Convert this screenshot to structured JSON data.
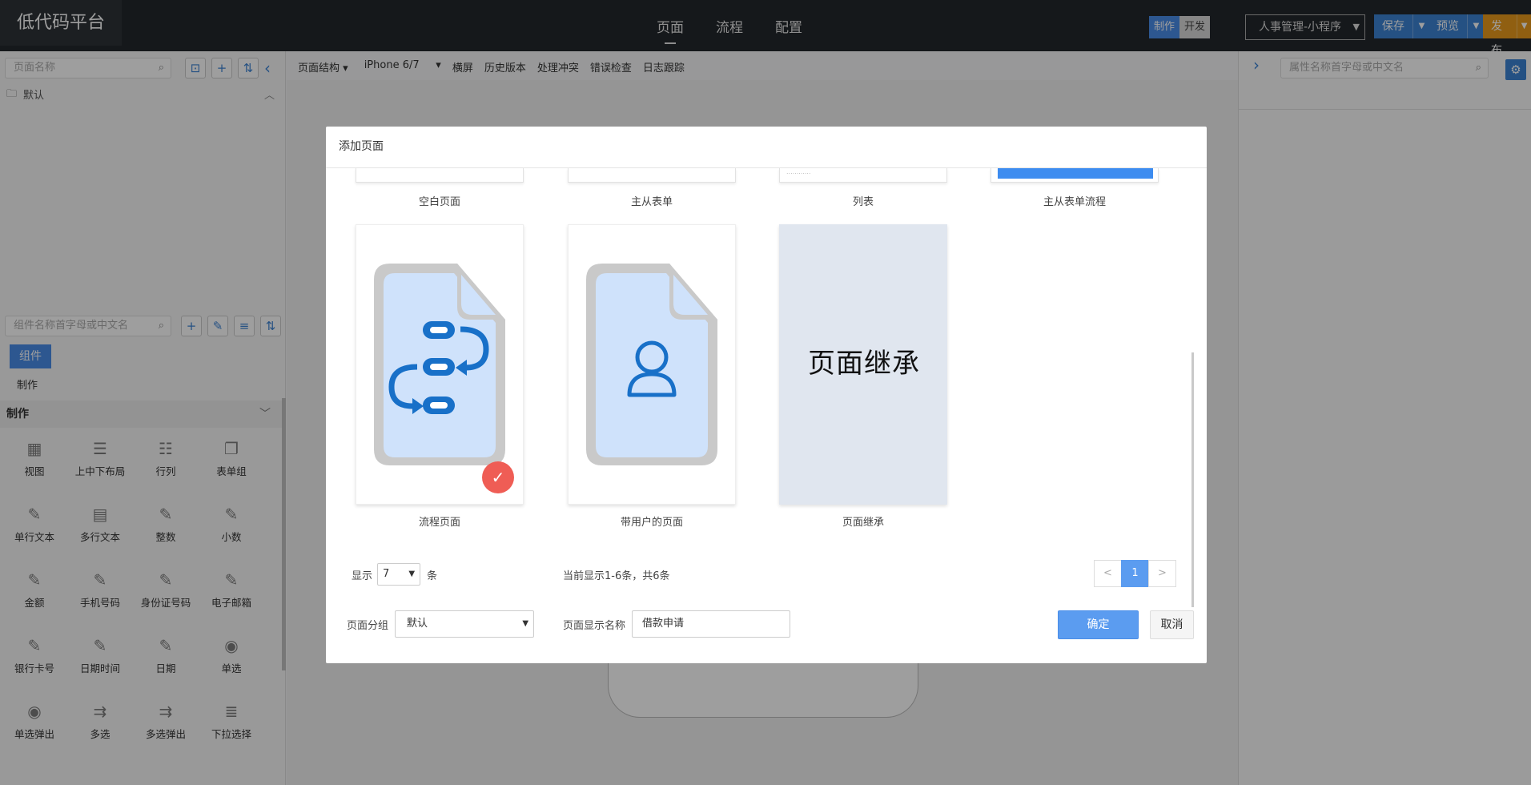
{
  "app": {
    "logo": "低代码平台"
  },
  "topnav": {
    "items": [
      "页面",
      "流程",
      "配置"
    ],
    "active": "页面"
  },
  "mode": {
    "on": "制作",
    "off": "开发"
  },
  "project_select": "人事管理-小程序",
  "toolbar_buttons": {
    "save": "保存",
    "preview": "预览",
    "publish": "发布"
  },
  "left": {
    "page_search_placeholder": "页面名称",
    "folder": "默认",
    "comp_search_placeholder": "组件名称首字母或中文名",
    "tab": "组件",
    "plain_label": "制作",
    "section": "制作",
    "components": [
      {
        "name": "视图",
        "icon": "view-icon"
      },
      {
        "name": "上中下布局",
        "icon": "layout-icon"
      },
      {
        "name": "行列",
        "icon": "rows-icon"
      },
      {
        "name": "表单组",
        "icon": "form-group-icon"
      },
      {
        "name": "单行文本",
        "icon": "edit-icon"
      },
      {
        "name": "多行文本",
        "icon": "textarea-icon"
      },
      {
        "name": "整数",
        "icon": "edit-icon"
      },
      {
        "name": "小数",
        "icon": "edit-icon"
      },
      {
        "name": "金额",
        "icon": "edit-icon"
      },
      {
        "name": "手机号码",
        "icon": "edit-icon"
      },
      {
        "name": "身份证号码",
        "icon": "edit-icon"
      },
      {
        "name": "电子邮箱",
        "icon": "edit-icon"
      },
      {
        "name": "银行卡号",
        "icon": "edit-icon"
      },
      {
        "name": "日期时间",
        "icon": "edit-icon"
      },
      {
        "name": "日期",
        "icon": "edit-icon"
      },
      {
        "name": "单选",
        "icon": "radio-icon"
      },
      {
        "name": "单选弹出",
        "icon": "radio-icon"
      },
      {
        "name": "多选",
        "icon": "multi-select-icon"
      },
      {
        "name": "多选弹出",
        "icon": "multi-select-icon"
      },
      {
        "name": "下拉选择",
        "icon": "dropdown-list-icon"
      }
    ]
  },
  "center_toolbar": {
    "page_structure": "页面结构",
    "device": "iPhone 6/7",
    "items": [
      "横屏",
      "历史版本",
      "处理冲突",
      "错误检查",
      "日志跟踪"
    ]
  },
  "right": {
    "search_placeholder": "属性名称首字母或中文名"
  },
  "modal": {
    "title": "添加页面",
    "top_cards": [
      "空白页面",
      "主从表单",
      "列表",
      "主从表单流程"
    ],
    "cards": [
      {
        "label": "流程页面",
        "selected": true
      },
      {
        "label": "带用户的页面",
        "selected": false
      },
      {
        "label": "页面继承",
        "selected": false,
        "thumb_title": "页面继承"
      }
    ],
    "display_label": "显示",
    "page_size": "7",
    "unit": "条",
    "status": "当前显示1-6条，共6条",
    "pager": {
      "prev": "<",
      "current": "1",
      "next": ">"
    },
    "group_label": "页面分组",
    "group_value": "默认",
    "name_label": "页面显示名称",
    "name_value": "借款申请",
    "ok": "确定",
    "cancel": "取消"
  }
}
